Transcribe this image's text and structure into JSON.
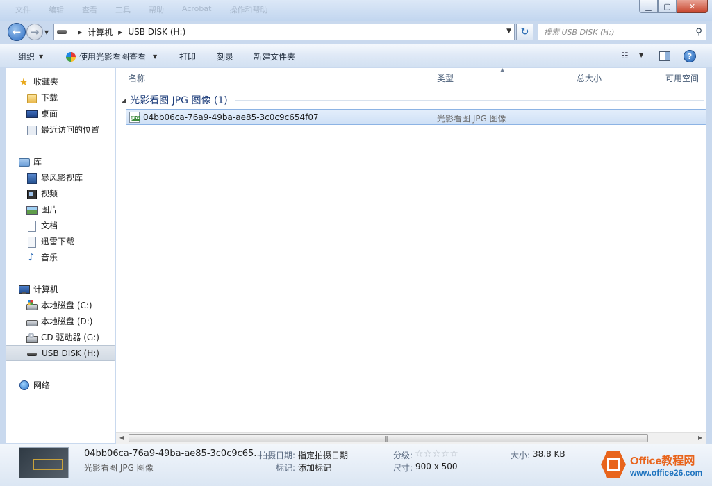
{
  "window": {
    "ghost_menu": [
      "文件",
      "编辑",
      "查看",
      "工具",
      "帮助",
      "Acrobat",
      "操作和帮助"
    ],
    "controls": {
      "minimize": "▁",
      "maximize": "▢",
      "close": "✕"
    }
  },
  "address_bar": {
    "crumbs": [
      "计算机",
      "USB DISK (H:)"
    ]
  },
  "search": {
    "placeholder": "搜索 USB DISK (H:)"
  },
  "toolbar": {
    "organize": "组织",
    "open_with": "使用光影看图查看",
    "print": "打印",
    "burn": "刻录",
    "new_folder": "新建文件夹"
  },
  "sidebar": {
    "favorites": {
      "label": "收藏夹",
      "items": [
        "下载",
        "桌面",
        "最近访问的位置"
      ]
    },
    "libraries": {
      "label": "库",
      "items": [
        "暴风影视库",
        "视频",
        "图片",
        "文档",
        "迅雷下载",
        "音乐"
      ]
    },
    "computer": {
      "label": "计算机",
      "items": [
        "本地磁盘 (C:)",
        "本地磁盘 (D:)",
        "CD 驱动器 (G:)",
        "USB DISK (H:)"
      ]
    },
    "network": {
      "label": "网络"
    }
  },
  "columns": [
    "名称",
    "类型",
    "总大小",
    "可用空间"
  ],
  "group": {
    "label": "光影看图 JPG 图像 (1)"
  },
  "files": [
    {
      "name": "04bb06ca-76a9-49ba-ae85-3c0c9c654f07",
      "type": "光影看图 JPG 图像",
      "icon": "JPG"
    }
  ],
  "details": {
    "title": "04bb06ca-76a9-49ba-ae85-3c0c9c65...",
    "subtitle": "光影看图 JPG 图像",
    "date_label": "拍摄日期:",
    "date_value": "指定拍摄日期",
    "tags_label": "标记:",
    "tags_value": "添加标记",
    "rating_label": "分级:",
    "rating_stars": "☆☆☆☆☆",
    "dims_label": "尺寸:",
    "dims_value": "900 x 500",
    "size_label": "大小:",
    "size_value": "38.8 KB"
  },
  "watermark": {
    "line1": "Office教程网",
    "line2": "www.office26.com"
  }
}
